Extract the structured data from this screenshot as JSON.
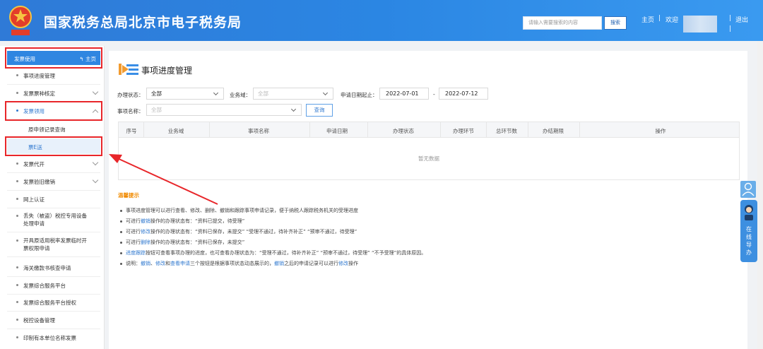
{
  "header": {
    "title": "国家税务总局北京市电子税务局",
    "search_placeholder": "请输入需要搜索的内容",
    "search_button": "搜索",
    "home_link": "主页",
    "welcome": "欢迎",
    "sep": "|",
    "logout": "退出"
  },
  "sidebar": {
    "head_title": "发票使用",
    "head_home": "主页",
    "items": [
      {
        "label": "事项进度管理"
      },
      {
        "label": "发票票种核定"
      },
      {
        "label": "发票领用"
      },
      {
        "label": "原申领记录查询"
      },
      {
        "label": "票E送"
      },
      {
        "label": "发票代开"
      },
      {
        "label": "发票验旧缴销"
      },
      {
        "label": "网上认证"
      },
      {
        "label": "丢失（被盗）税控专用设备处理申请"
      },
      {
        "label": "开具原适用税率发票临时开票权限申请"
      },
      {
        "label": "海关缴款书核查申请"
      },
      {
        "label": "发票综合服务平台"
      },
      {
        "label": "发票综合服务平台授权"
      },
      {
        "label": "税控设备管理"
      },
      {
        "label": "印制有本单位名称发票"
      }
    ]
  },
  "main": {
    "page_title": "事项进度管理",
    "filters": {
      "status_label": "办理状态：",
      "status_value": "全部",
      "domain_label": "业务域：",
      "domain_placeholder": "全部",
      "date_label": "申请日期起止：",
      "date_from": "2022-07-01",
      "date_dash": "-",
      "date_to": "2022-07-12",
      "name_label": "事项名称：",
      "name_placeholder": "全部",
      "query_button": "查询"
    },
    "table": {
      "headers": [
        "序号",
        "业务域",
        "事项名称",
        "申请日期",
        "办理状态",
        "办理环节",
        "总环节数",
        "办结期限",
        "操作"
      ],
      "empty_text": "暂无数据"
    },
    "tips": {
      "title": "温馨提示",
      "line1": "事项进度管理可以进行查看、修改、删除、撤销和跟踪事项申请记录，便于纳税人跟踪税务机关的受理进度",
      "line2_a": "可进行",
      "line2_hl": "撤销",
      "line2_b": "操作的办理状态有：“资料已提交，待受理”",
      "line3_a": "可进行",
      "line3_hl": "修改",
      "line3_b": "操作的办理状态有：“资料已保存，未提交” “受理不通过，待补齐补正” “预审不通过，待受理”",
      "line4_a": "可进行",
      "line4_hl": "删除",
      "line4_b": "操作的办理状态有：“资料已保存，未提交”",
      "line5_hl": "进度跟踪",
      "line5_b": "按钮可查看事项办理的进度，也可查看办理状态为：“受理不通过，待补齐补正” “预审不通过，待受理” “不予受理”的具体原因。",
      "line6_a": "说明：",
      "line6_hl1": "撤销",
      "line6_c1": "、",
      "line6_hl2": "修改",
      "line6_c2": "和",
      "line6_hl3": "查看申请",
      "line6_b": "三个按钮是根据事项状态动态展示的，",
      "line6_hl4": "撤销",
      "line6_d": "之后的申请记录可以进行",
      "line6_hl5": "修改",
      "line6_e": "操作"
    }
  },
  "float": {
    "guide_text": "在线导办"
  },
  "colors": {
    "header_blue": "#2b86e3",
    "accent_blue": "#2f78cf",
    "annotation_red": "#e8262a",
    "tip_orange": "#f08a00"
  }
}
